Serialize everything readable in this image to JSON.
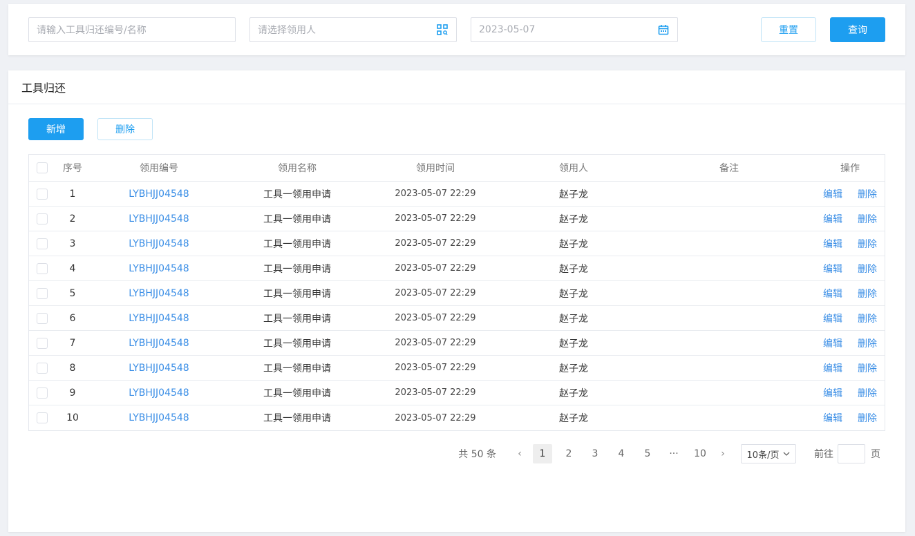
{
  "filters": {
    "code_placeholder": "请输入工具归还编号/名称",
    "person_placeholder": "请选择领用人",
    "date_value": "2023-05-07",
    "reset_label": "重置",
    "query_label": "查询"
  },
  "panel": {
    "title": "工具归还",
    "add_label": "新增",
    "delete_label": "删除"
  },
  "table": {
    "headers": {
      "index": "序号",
      "code": "领用编号",
      "name": "领用名称",
      "time": "领用时间",
      "person": "领用人",
      "note": "备注",
      "ops": "操作"
    },
    "rows": [
      {
        "index": "1",
        "code": "LYBHJJ04548",
        "name": "工具一领用申请",
        "time": "2023-05-07 22:29",
        "person": "赵子龙",
        "note": "",
        "edit": "编辑",
        "delete": "删除"
      },
      {
        "index": "2",
        "code": "LYBHJJ04548",
        "name": "工具一领用申请",
        "time": "2023-05-07 22:29",
        "person": "赵子龙",
        "note": "",
        "edit": "编辑",
        "delete": "删除"
      },
      {
        "index": "3",
        "code": "LYBHJJ04548",
        "name": "工具一领用申请",
        "time": "2023-05-07 22:29",
        "person": "赵子龙",
        "note": "",
        "edit": "编辑",
        "delete": "删除"
      },
      {
        "index": "4",
        "code": "LYBHJJ04548",
        "name": "工具一领用申请",
        "time": "2023-05-07 22:29",
        "person": "赵子龙",
        "note": "",
        "edit": "编辑",
        "delete": "删除"
      },
      {
        "index": "5",
        "code": "LYBHJJ04548",
        "name": "工具一领用申请",
        "time": "2023-05-07 22:29",
        "person": "赵子龙",
        "note": "",
        "edit": "编辑",
        "delete": "删除"
      },
      {
        "index": "6",
        "code": "LYBHJJ04548",
        "name": "工具一领用申请",
        "time": "2023-05-07 22:29",
        "person": "赵子龙",
        "note": "",
        "edit": "编辑",
        "delete": "删除"
      },
      {
        "index": "7",
        "code": "LYBHJJ04548",
        "name": "工具一领用申请",
        "time": "2023-05-07 22:29",
        "person": "赵子龙",
        "note": "",
        "edit": "编辑",
        "delete": "删除"
      },
      {
        "index": "8",
        "code": "LYBHJJ04548",
        "name": "工具一领用申请",
        "time": "2023-05-07 22:29",
        "person": "赵子龙",
        "note": "",
        "edit": "编辑",
        "delete": "删除"
      },
      {
        "index": "9",
        "code": "LYBHJJ04548",
        "name": "工具一领用申请",
        "time": "2023-05-07 22:29",
        "person": "赵子龙",
        "note": "",
        "edit": "编辑",
        "delete": "删除"
      },
      {
        "index": "10",
        "code": "LYBHJJ04548",
        "name": "工具一领用申请",
        "time": "2023-05-07 22:29",
        "person": "赵子龙",
        "note": "",
        "edit": "编辑",
        "delete": "删除"
      }
    ]
  },
  "pagination": {
    "total": "共 50 条",
    "prev": "‹",
    "next": "›",
    "pages": [
      "1",
      "2",
      "3",
      "4",
      "5"
    ],
    "ellipsis": "···",
    "last_page": "10",
    "current": "1",
    "page_size": "10条/页",
    "goto_label": "前往",
    "page_suffix": "页"
  },
  "colors": {
    "primary": "#1d9ef0",
    "link": "#3a8ee6"
  }
}
